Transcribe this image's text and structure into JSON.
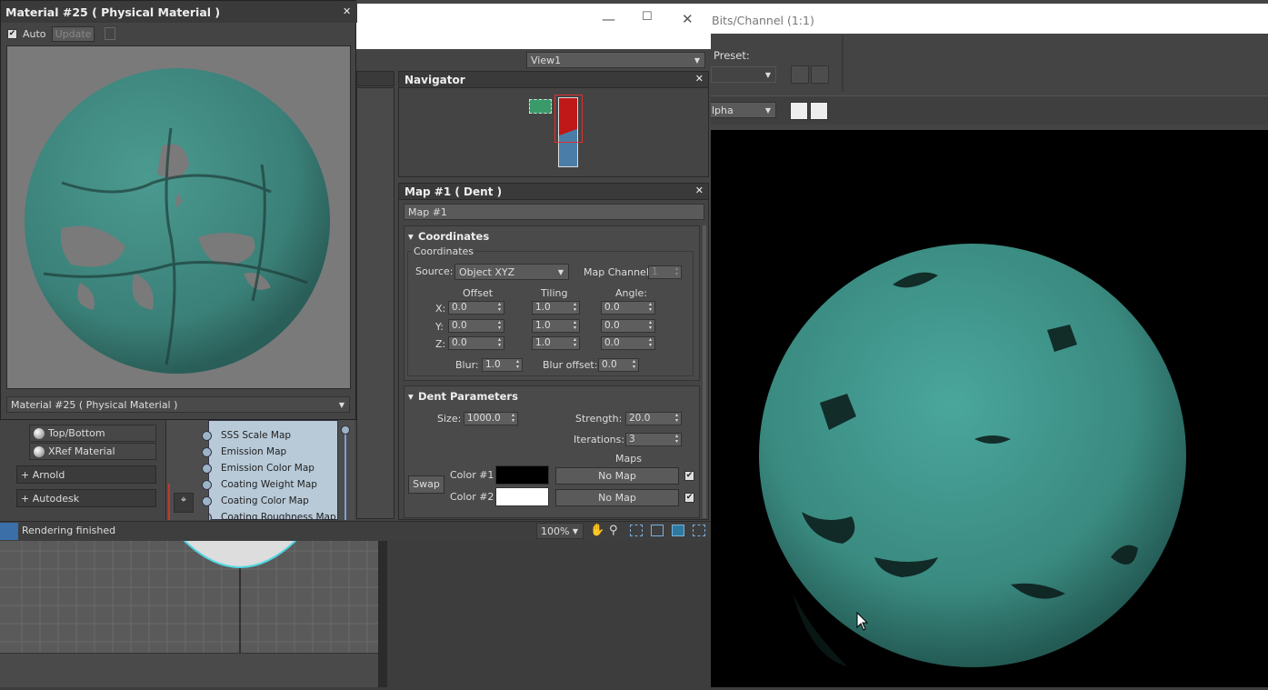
{
  "material_window": {
    "title": "Material #25  ( Physical Material )",
    "auto_label": "Auto",
    "update_label": "Update",
    "footer_label": "Material #25  ( Physical Material )"
  },
  "slate": {
    "view_selector": "View1",
    "navigator_title": "Navigator",
    "map_title": "Map #1  ( Dent )",
    "map_name": "Map #1",
    "coordinates": {
      "rollout_title": "Coordinates",
      "group_label": "Coordinates",
      "source_label": "Source:",
      "source_value": "Object XYZ",
      "map_channel_label": "Map Channel:",
      "map_channel_value": "1",
      "offset_header": "Offset",
      "tiling_header": "Tiling",
      "angle_header": "Angle:",
      "x_label": "X:",
      "y_label": "Y:",
      "z_label": "Z:",
      "offset": [
        "0.0",
        "0.0",
        "0.0"
      ],
      "tiling": [
        "1.0",
        "1.0",
        "1.0"
      ],
      "angle": [
        "0.0",
        "0.0",
        "0.0"
      ],
      "blur_label": "Blur:",
      "blur_value": "1.0",
      "blur_offset_label": "Blur offset:",
      "blur_offset_value": "0.0"
    },
    "dent": {
      "rollout_title": "Dent Parameters",
      "size_label": "Size:",
      "size_value": "1000.0",
      "strength_label": "Strength:",
      "strength_value": "20.0",
      "iterations_label": "Iterations:",
      "iterations_value": "3",
      "maps_label": "Maps",
      "swap_label": "Swap",
      "color1_label": "Color #1",
      "color2_label": "Color #2",
      "color1": "#000000",
      "color2": "#ffffff",
      "map1_label": "No Map",
      "map2_label": "No Map"
    },
    "browser": {
      "items": [
        "Top/Bottom",
        "XRef Material"
      ],
      "groups": [
        "+ Arnold",
        "+ Autodesk"
      ]
    },
    "node_slots": [
      "SSS Scale Map",
      "Emission Map",
      "Emission Color Map",
      "Coating Weight Map",
      "Coating Color Map",
      "Coating Roughness Map"
    ],
    "status_text": "Rendering finished",
    "zoom_value": "100%"
  },
  "render_window": {
    "title_fragment": "Bits/Channel (1:1)",
    "preset_label": "Preset:",
    "channel_value": "lpha"
  },
  "colors": {
    "material_teal": "#3a8a80",
    "background_dark": "#444444"
  }
}
